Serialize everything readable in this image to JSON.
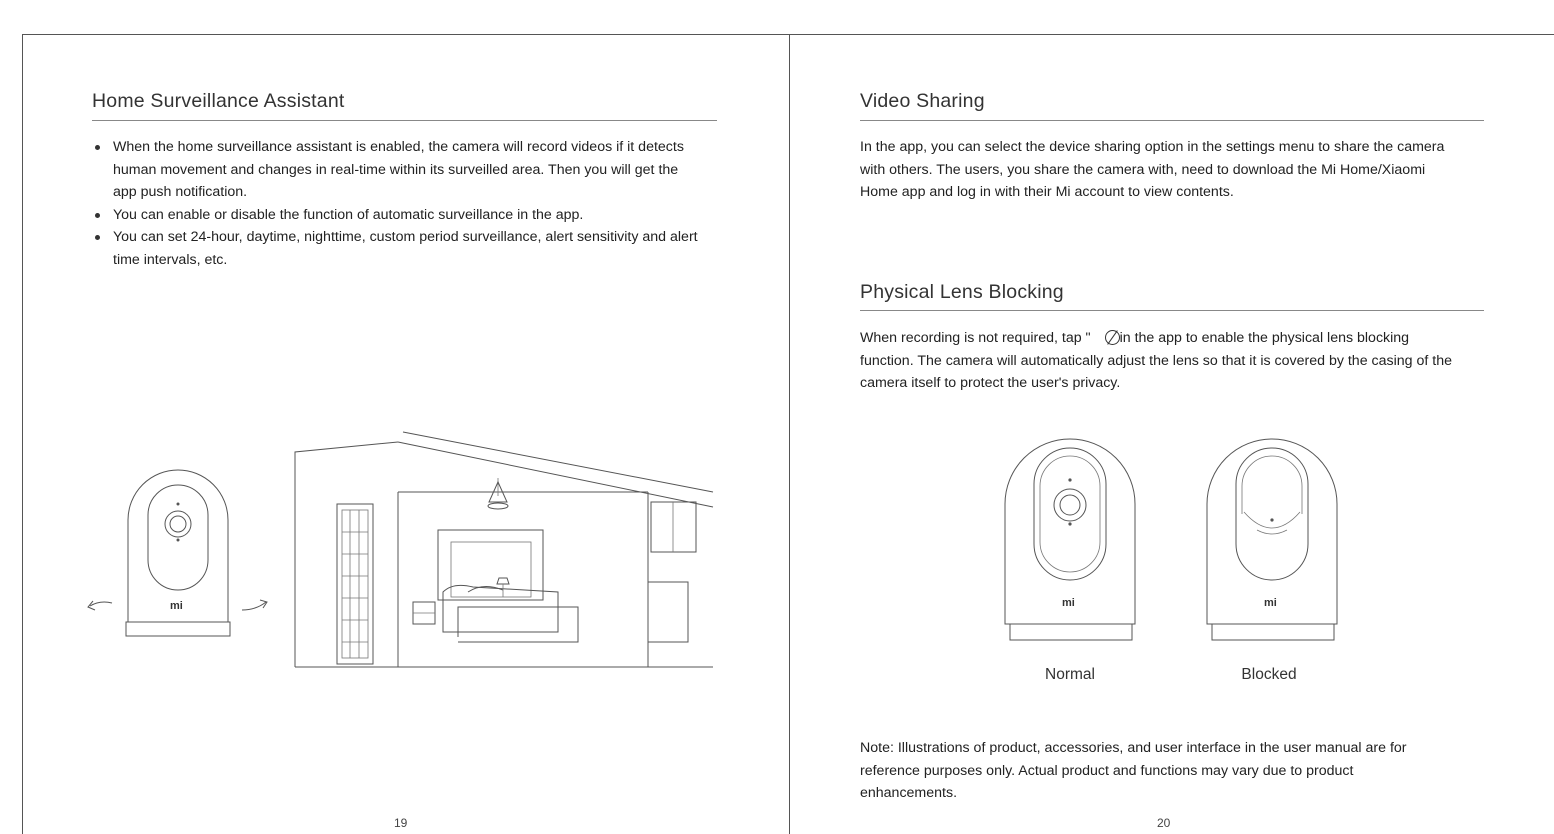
{
  "left_page": {
    "heading": "Home Surveillance Assistant",
    "bullets": [
      "When the home surveillance assistant is enabled, the camera will record videos if it detects human movement and changes in real-time within its surveilled area. Then you will get the app push notification.",
      "You can enable or disable the function of automatic surveillance in the app.",
      "You can set 24-hour, daytime, nighttime, custom period surveillance, alert sensitivity and alert time intervals, etc."
    ],
    "camera_logo": "mi",
    "page_number": "19"
  },
  "right_page": {
    "video_sharing": {
      "heading": "Video Sharing",
      "text": "In the app, you can select the device sharing option in the settings menu to share the camera with others. The users, you share the camera with, need to download the Mi Home/Xiaomi Home app and log in with their Mi account to view contents."
    },
    "lens_blocking": {
      "heading": "Physical Lens Blocking",
      "text_before_icon": "When recording is not required, tap \"",
      "text_after_icon": "in the app to enable the physical lens blocking function. The camera will automatically adjust the lens so that it is covered by the casing of the camera itself to protect the user's privacy.",
      "icon": "lens-block-icon"
    },
    "figures": [
      {
        "caption": "Normal",
        "logo": "mi"
      },
      {
        "caption": "Blocked",
        "logo": "mi"
      }
    ],
    "note": "Note: Illustrations of product, accessories, and user interface in the user manual are for reference purposes only. Actual product and functions may vary due to product enhancements.",
    "page_number": "20"
  }
}
